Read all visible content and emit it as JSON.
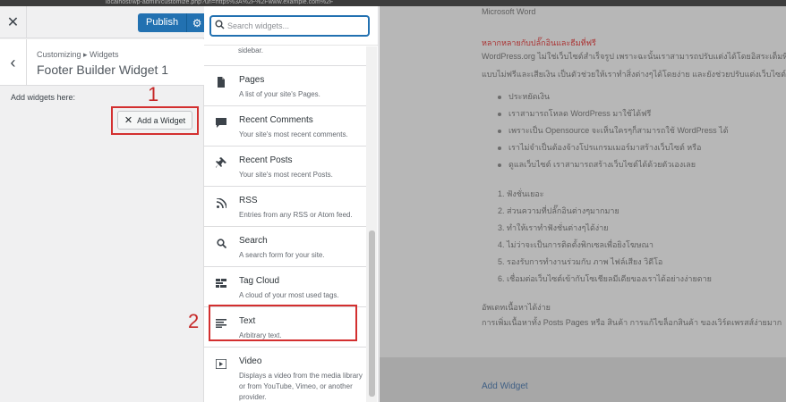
{
  "browser": {
    "url": "localhost/wp-admin/customize.php?url=https%3A%2F%2Fwww.example.com%2F"
  },
  "customizer": {
    "publish_label": "Publish",
    "breadcrumb": "Customizing ▸ Widgets",
    "section_title": "Footer Builder Widget 1",
    "add_here_text": "Add widgets here:",
    "add_widget_label": "Add a Widget",
    "marker_1": "1"
  },
  "widget_chooser": {
    "search_placeholder": "Search widgets...",
    "top_snippet": "sidebar.",
    "items": [
      {
        "title": "Pages",
        "desc": "A list of your site's Pages.",
        "icon": "page-icon"
      },
      {
        "title": "Recent Comments",
        "desc": "Your site's most recent comments.",
        "icon": "comment-icon"
      },
      {
        "title": "Recent Posts",
        "desc": "Your site's most recent Posts.",
        "icon": "pin-icon"
      },
      {
        "title": "RSS",
        "desc": "Entries from any RSS or Atom feed.",
        "icon": "rss-icon"
      },
      {
        "title": "Search",
        "desc": "A search form for your site.",
        "icon": "search-icon"
      },
      {
        "title": "Tag Cloud",
        "desc": "A cloud of your most used tags.",
        "icon": "tag-cloud-icon"
      },
      {
        "title": "Text",
        "desc": "Arbitrary text.",
        "icon": "text-align-icon"
      },
      {
        "title": "Video",
        "desc": "Displays a video from the media library or from YouTube, Vimeo, or another provider.",
        "icon": "video-icon"
      }
    ],
    "marker_2": "2"
  },
  "preview": {
    "heading_cut": "Microsoft Word",
    "red_heading": "หลากหลายกับปลั๊กอินและธีมที่ฟรี",
    "para_1": "WordPress.org ไม่ใช่เว็บไซต์สำเร็จรูป เพราะฉะนั้นเราสามารถปรับแต่งได้โดยอิสระเต็มที่",
    "para_2": "แบบไม่ฟรีและเสียเงิน เป็นตัวช่วยให้เราทำสิ่งต่างๆได้โดยง่าย และยังช่วยปรับแต่งเว็บไซต์",
    "bullets": [
      "ประหยัดเงิน",
      "เราสามารถโหลด WordPress มาใช้ได้ฟรี",
      "เพราะเป็น Opensource จะเห็นใครๆก็สามารถใช้ WordPress ได้",
      "เราไม่จำเป็นต้องจ้างโปรแกรมเมอร์มาสร้างเว็บไซต์ หรือ",
      "ดูแลเว็บไซต์ เราสามารถสร้างเว็บไซต์ได้ด้วยตัวเองเลย"
    ],
    "numbered": [
      "1. ฟังชั่นเยอะ",
      "2. ส่วนความที่ปลั๊กอินต่างๆมากมาย",
      "3. ทำให้เราทำฟังชั่นต่างๆได้ง่าย",
      "4. ไม่ว่าจะเป็นการติดตั้งพิกเซลเพื่อยิงโฆษณา",
      "5. รองรับการทำงานร่วมกับ ภาพ ไฟล์เสียง วิดีโอ",
      "6. เชื่อมต่อเว็บไซต์เข้ากับโซเชียลมีเดียของเราได้อย่างง่ายดาย"
    ],
    "subheading": "อัพเดทเนื้อหาได้ง่าย",
    "para_3": "การเพิ่มเนื้อหาทั้ง Posts Pages หรือ สินค้า การแก้ไขล็อกสินค้า ของเวิร์ดเพรสส์ง่ายมาก",
    "add_widget_link": "Add Widget"
  },
  "colors": {
    "accent": "#2271b1",
    "annotation_red": "#d32f2f"
  }
}
